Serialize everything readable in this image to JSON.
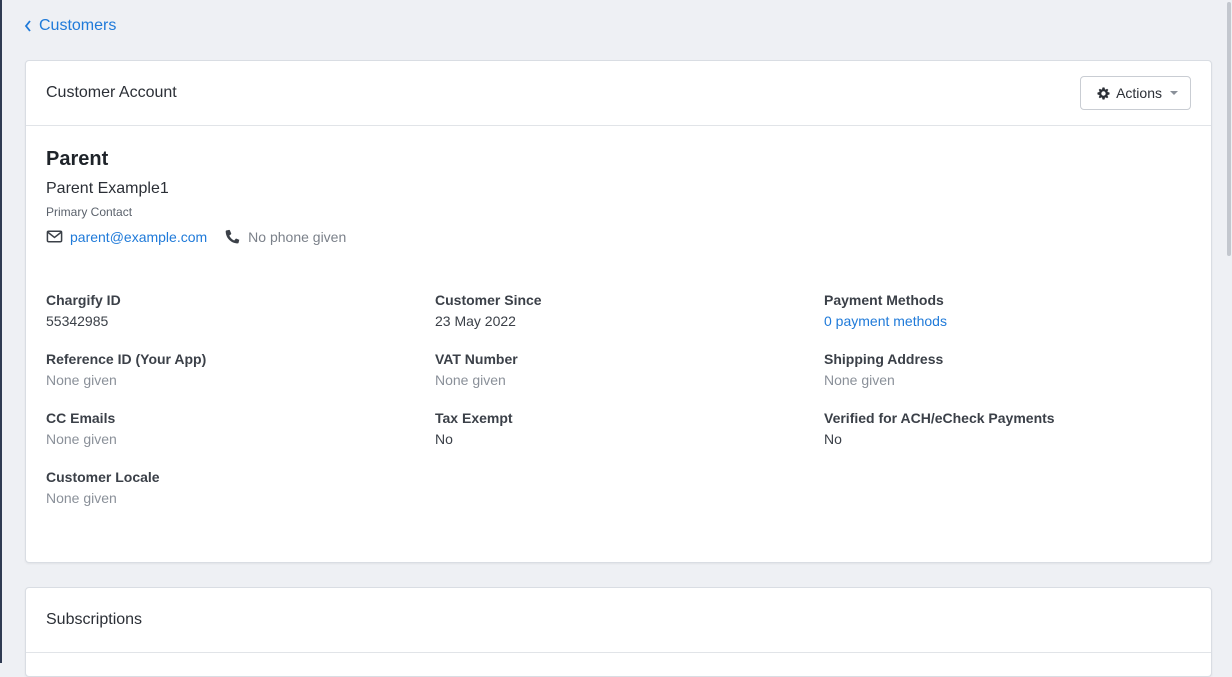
{
  "nav": {
    "back_label": "Customers"
  },
  "account": {
    "title": "Customer Account",
    "actions_label": "Actions",
    "customer_name": "Parent",
    "contact_name": "Parent Example1",
    "contact_role": "Primary Contact",
    "email": "parent@example.com",
    "phone": "No phone given",
    "fields": [
      {
        "label": "Chargify ID",
        "value": "55342985",
        "style": "normal"
      },
      {
        "label": "Customer Since",
        "value": "23 May 2022",
        "style": "normal"
      },
      {
        "label": "Payment Methods",
        "value": "0 payment methods",
        "style": "link"
      },
      {
        "label": "Reference ID (Your App)",
        "value": "None given",
        "style": "muted"
      },
      {
        "label": "VAT Number",
        "value": "None given",
        "style": "muted"
      },
      {
        "label": "Shipping Address",
        "value": "None given",
        "style": "muted"
      },
      {
        "label": "CC Emails",
        "value": "None given",
        "style": "muted"
      },
      {
        "label": "Tax Exempt",
        "value": "No",
        "style": "normal"
      },
      {
        "label": "Verified for ACH/eCheck Payments",
        "value": "No",
        "style": "normal"
      },
      {
        "label": "Customer Locale",
        "value": "None given",
        "style": "muted"
      }
    ]
  },
  "subscriptions": {
    "title": "Subscriptions"
  },
  "icons": {
    "back": "chevron-left-icon",
    "actions": "gear-icon",
    "email": "envelope-icon",
    "phone": "phone-icon"
  },
  "colors": {
    "link": "#1f7ad9",
    "muted_text": "#8a9099",
    "page_background": "#eef0f4",
    "card_background": "#ffffff"
  }
}
